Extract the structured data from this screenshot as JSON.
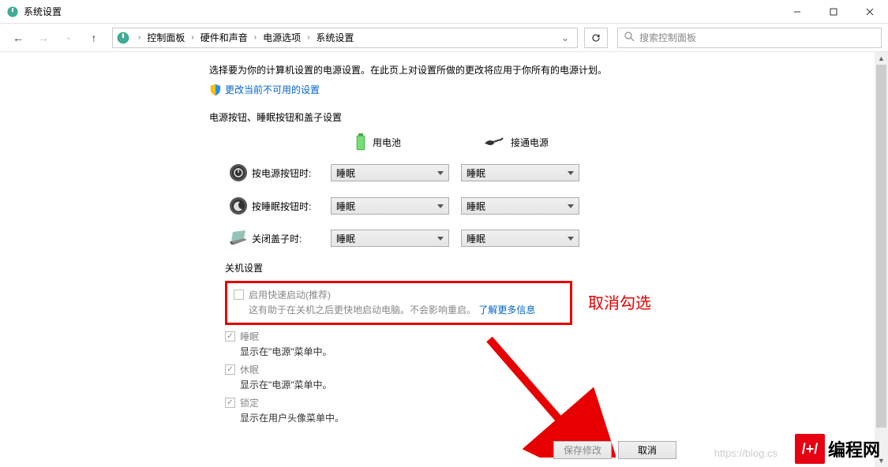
{
  "titlebar": {
    "title": "系统设置"
  },
  "breadcrumb": {
    "items": [
      "控制面板",
      "硬件和声音",
      "电源选项",
      "系统设置"
    ]
  },
  "search": {
    "placeholder": "搜索控制面板"
  },
  "intro": "选择要为你的计算机设置的电源设置。在此页上对设置所做的更改将应用于你所有的电源计划。",
  "admin_link": "更改当前不可用的设置",
  "section1": "电源按钮、睡眠按钮和盖子设置",
  "columns": {
    "battery": "用电池",
    "plugged": "接通电源"
  },
  "rows": {
    "power": {
      "label": "按电源按钮时:",
      "battery": "睡眠",
      "plugged": "睡眠"
    },
    "sleep": {
      "label": "按睡眠按钮时:",
      "battery": "睡眠",
      "plugged": "睡眠"
    },
    "lid": {
      "label": "关闭盖子时:",
      "battery": "睡眠",
      "plugged": "睡眠"
    }
  },
  "shutdown": {
    "title": "关机设置",
    "fast_start": {
      "label": "启用快速启动(推荐)",
      "desc_prefix": "这有助于在关机之后更快地启动电脑。不会影响重启。",
      "link": "了解更多信息"
    },
    "sleep": {
      "label": "睡眠",
      "desc": "显示在\"电源\"菜单中。"
    },
    "hibernate": {
      "label": "休眠",
      "desc": "显示在\"电源\"菜单中。"
    },
    "lock": {
      "label": "锁定",
      "desc": "显示在用户头像菜单中。"
    }
  },
  "annotation": "取消勾选",
  "buttons": {
    "save": "保存修改",
    "cancel": "取消"
  },
  "watermark": "https://blog.cs",
  "logo_text": "编程网"
}
